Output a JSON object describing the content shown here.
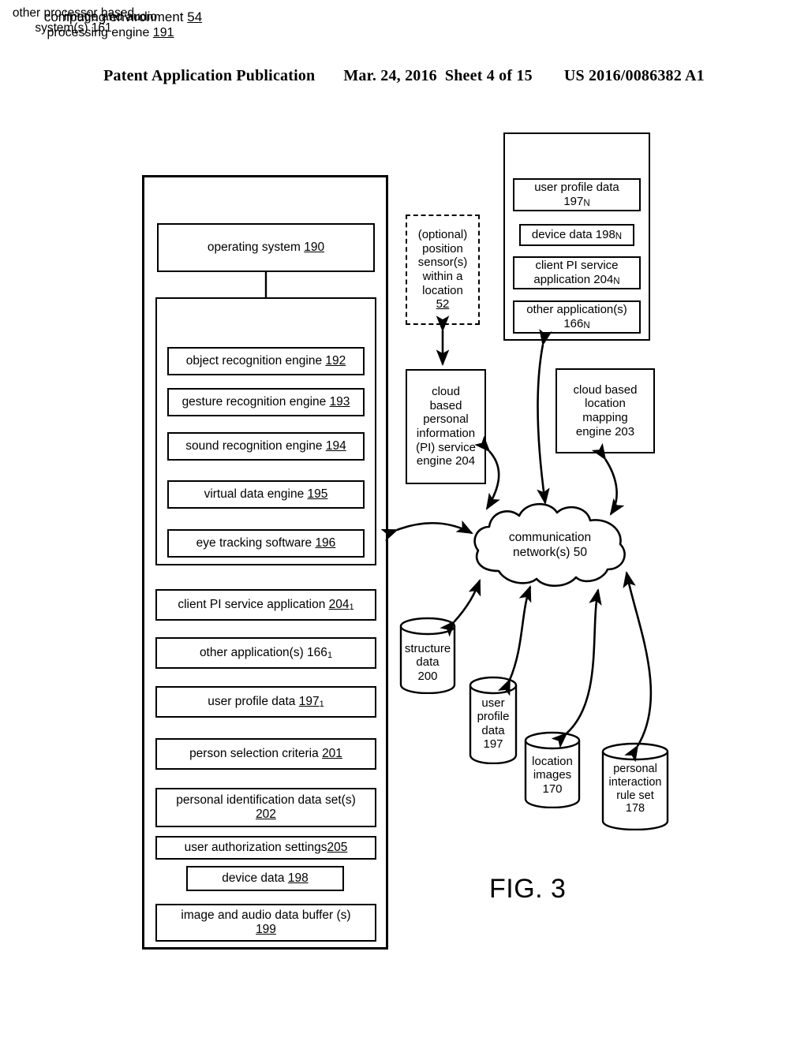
{
  "header": {
    "publication": "Patent Application Publication",
    "date": "Mar. 24, 2016",
    "sheet": "Sheet 4 of 15",
    "number": "US 2016/0086382 A1"
  },
  "figure": {
    "caption": "FIG. 3"
  },
  "computing_environment": {
    "title_text": "computing environment ",
    "title_ref": "54",
    "operating_system": {
      "text": "operating system ",
      "ref": "190"
    },
    "image_audio_engine": {
      "line1": "image and audio",
      "line2": "processing engine ",
      "ref": "191",
      "children": [
        {
          "text": "object recognition engine ",
          "ref": "192"
        },
        {
          "text": "gesture recognition engine ",
          "ref": "193"
        },
        {
          "text": "sound recognition engine ",
          "ref": "194"
        },
        {
          "text": "virtual data engine ",
          "ref": "195"
        },
        {
          "text": "eye tracking software ",
          "ref": "196"
        }
      ]
    },
    "modules": [
      {
        "text": "client PI service application ",
        "ref": "204",
        "subscript": "1"
      },
      {
        "text": "other application(s) 166",
        "ref": "",
        "subscript": "1"
      },
      {
        "text": "user profile data ",
        "ref": "197",
        "subscript": "1"
      },
      {
        "text": "person selection criteria ",
        "ref": "201",
        "subscript": ""
      }
    ],
    "personal_id_data_set": {
      "line1": "personal identification data set(s)",
      "ref": "202"
    },
    "user_auth_settings": {
      "text": "user authorization settings",
      "ref": "205"
    },
    "device_data": {
      "text": "device data ",
      "ref": "198"
    },
    "image_audio_buffer": {
      "line1": "image and audio data buffer (s)",
      "ref": "199"
    }
  },
  "position_sensors": {
    "lines": [
      "(optional)",
      "position",
      "sensor(s)",
      "within a",
      "location"
    ],
    "ref": "52"
  },
  "other_processor_based_system": {
    "title_line1": "other processor based",
    "title_line2": "system(s) 161",
    "children": [
      {
        "line1": "user profile data",
        "line2": "197",
        "subscript": "N"
      },
      {
        "line1": "device data 198",
        "line2": "",
        "subscript": "N"
      },
      {
        "line1": "client PI service",
        "line2": "application 204",
        "subscript": "N"
      },
      {
        "line1": "other application(s)",
        "line2": "166",
        "subscript": "N"
      }
    ]
  },
  "cloud_pi_service_engine": {
    "lines": [
      "cloud",
      "based",
      "personal",
      "information",
      "(PI) service",
      "engine 204"
    ]
  },
  "cloud_location_mapping_engine": {
    "lines": [
      "cloud based",
      "location",
      "mapping",
      "engine 203"
    ]
  },
  "communication_network": {
    "line1": "communication",
    "line2": "network(s) 50"
  },
  "data_stores": [
    {
      "name": "structure-data",
      "lines": [
        "structure",
        "data",
        "200"
      ]
    },
    {
      "name": "user-profile-data",
      "lines": [
        "user",
        "profile",
        "data",
        "197"
      ]
    },
    {
      "name": "location-images",
      "lines": [
        "location",
        "images",
        "170"
      ]
    },
    {
      "name": "personal-interaction-rule-set",
      "lines": [
        "personal",
        "interaction",
        "rule set",
        "178"
      ]
    }
  ],
  "colors": {
    "ink": "#000000",
    "paper": "#ffffff"
  }
}
